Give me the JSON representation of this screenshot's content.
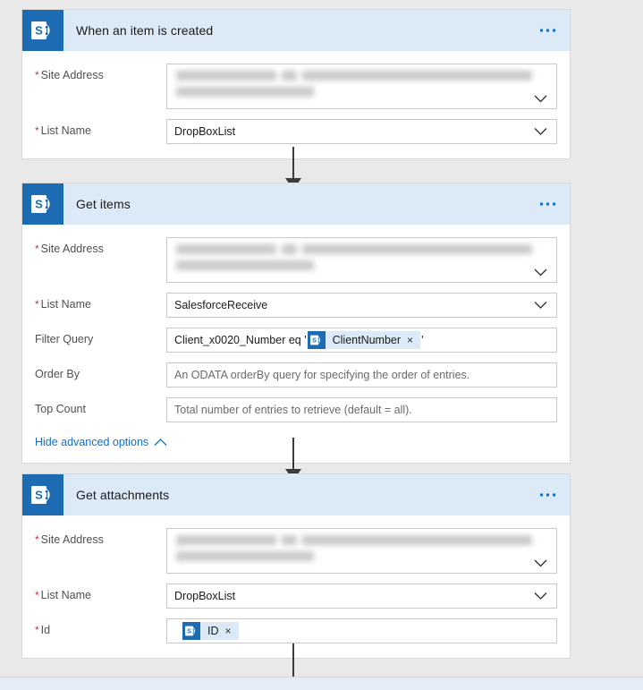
{
  "app": {
    "canvas_background": "#e9e9e9",
    "accent_color": "#0b6fd4",
    "sharepoint_blue": "#1d6cb3",
    "header_background": "#dce9f7"
  },
  "steps": [
    {
      "title": "When an item is created",
      "icon": "sharepoint-icon",
      "menu_label": "···",
      "fields": [
        {
          "label": "Site Address",
          "required": true,
          "type": "dropdown-redacted",
          "value": "",
          "redacted": true
        },
        {
          "label": "List Name",
          "required": true,
          "type": "dropdown",
          "value": "DropBoxList"
        }
      ]
    },
    {
      "title": "Get items",
      "icon": "sharepoint-icon",
      "menu_label": "···",
      "fields": [
        {
          "label": "Site Address",
          "required": true,
          "type": "dropdown-redacted",
          "value": "",
          "redacted": true
        },
        {
          "label": "List Name",
          "required": true,
          "type": "dropdown",
          "value": "SalesforceReceive"
        },
        {
          "label": "Filter Query",
          "required": false,
          "type": "token-expression",
          "prefix": "Client_x0020_Number eq '",
          "token": "ClientNumber",
          "token_close": "×",
          "suffix": "'"
        },
        {
          "label": "Order By",
          "required": false,
          "type": "text",
          "placeholder": "An ODATA orderBy query for specifying the order of entries."
        },
        {
          "label": "Top Count",
          "required": false,
          "type": "text",
          "placeholder": "Total number of entries to retrieve (default = all)."
        }
      ],
      "advanced_options_label": "Hide advanced options"
    },
    {
      "title": "Get attachments",
      "icon": "sharepoint-icon",
      "menu_label": "···",
      "fields": [
        {
          "label": "Site Address",
          "required": true,
          "type": "dropdown-redacted",
          "value": "",
          "redacted": true
        },
        {
          "label": "List Name",
          "required": true,
          "type": "dropdown",
          "value": "DropBoxList"
        },
        {
          "label": "Id",
          "required": true,
          "type": "token-only",
          "token": "ID",
          "token_close": "×"
        }
      ]
    }
  ]
}
